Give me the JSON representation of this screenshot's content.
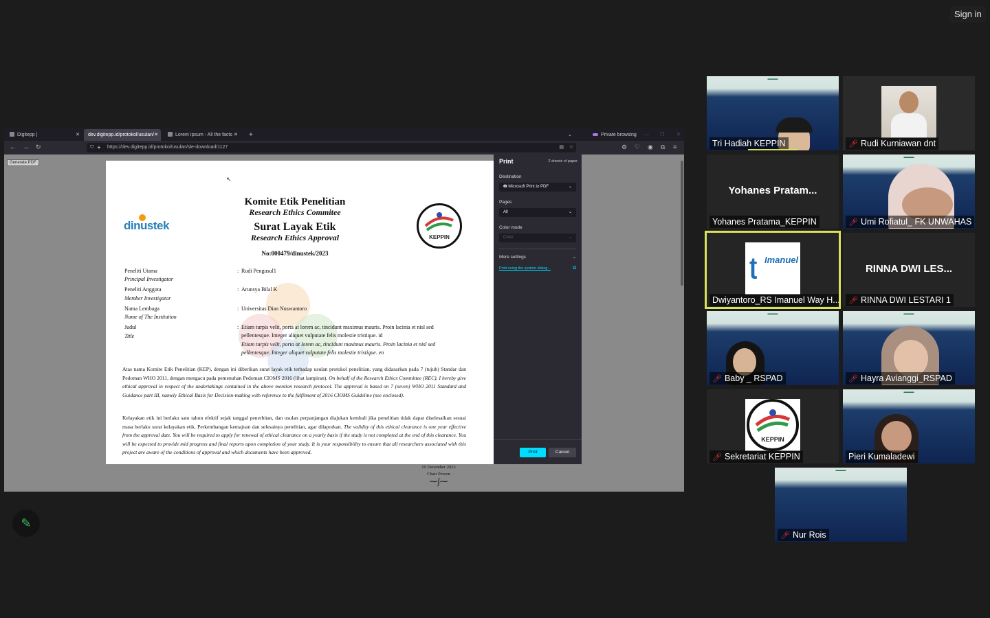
{
  "signin": "Sign in",
  "browser": {
    "tabs": [
      {
        "label": "Digitepp |"
      },
      {
        "label": "dev.digitepp.id/protokol/usulan/sle-"
      },
      {
        "label": "Lorem Ipsum - All the facts - Li"
      }
    ],
    "new_tab": "+",
    "private": "Private browsing",
    "url": "https://dev.digitepp.id/protokol/usulan/sle-download/1127",
    "generate_pdf": "Generate PDF"
  },
  "document": {
    "org_logo_text": "dinustek",
    "title1": "Komite Etik Penelitian",
    "title1_en": "Research Ethics Commitee",
    "title2": "Surat Layak Etik",
    "title2_en": "Research Ethics Approval",
    "number": "No:000479/dinustek/2023",
    "keppin_logo_text": "KEPPIN",
    "fields": [
      {
        "label": "Peneliti Utama",
        "label_en": "Principal Investigator",
        "value": "Rudi Pengusul1",
        "value_en": ""
      },
      {
        "label": "Peneliti Anggota",
        "label_en": "Member Investigator",
        "value": "Arunsya Bilal K",
        "value_en": ""
      },
      {
        "label": "Nama Lembaga",
        "label_en": "Name of The Institution",
        "value": "Universitas Dian Nuswantoro",
        "value_en": ""
      },
      {
        "label": "Judul",
        "label_en": "Title",
        "value": "Etiam turpis velit, porta at lorem ac, tincidunt maximus mauris. Proin lacinia et nisl sed pellentesque. Integer aliquet vulputate felis molestie tristique. id",
        "value_en": "Etiam turpis velit, porta at lorem ac, tincidunt maximus mauris. Proin lacinia et nisl sed pellentesque. Integer aliquet vulputate felis molestie tristique. en"
      }
    ],
    "colon": ":",
    "para1_id": "Atas nama Komite Etik Penelitian (KEP), dengan ini diberikan surat layak etik terhadap usulan protokol penelitian, yang didasarkan pada 7 (tujuh) Standar dan Pedoman WHO 2011, dengan mengacu pada pemenuhan Pedoman CIOMS 2016 (lihat lampiran).",
    "para1_en": "On behalf of the Research Ethics Committee (REC), I hereby give ethical approval in respect of the undertakings contained in the above mention research protocol. The approval is based on 7 (seven) WHO 2011 Standard and Guidance part III, namely Ethical Basis for Decision-making with reference to the fulfilment of 2016 CIOMS Guideline (see enclosed).",
    "para2_id": "Kelayakan etik ini berlaku satu tahun efektif sejak tanggal penerbitan, dan usulan perpanjangan diajukan kembali jika penelitian tidak dapat diselesaikan sesuai masa berlaku surat kelayakan etik. Perkembangan kemajuan dan selesainya penelitian, agar dilaporkan.",
    "para2_en": "The validity of this ethical clearance is one year effective from the approval date. You will be required to apply for renewal of ethical clearance on a yearly basis if the study is not completed at the end of this clearance. You will be expected to provide mid progress and final reports upon completion of your study. It is your responsibility to ensure that all researchers associated with this project are aware of the conditions of approval and which documents have been approved.",
    "date": "10 December 2023",
    "chair": "Chair Person"
  },
  "print_dialog": {
    "title": "Print",
    "sheets": "2 sheets of paper",
    "destination_label": "Destination",
    "destination_value": "Microsoft Print to PDF",
    "pages_label": "Pages",
    "pages_value": "All",
    "color_label": "Color mode",
    "color_value": "Color",
    "more_settings": "More settings",
    "system_dialog": "Print using the system dialog...",
    "print_btn": "Print",
    "cancel_btn": "Cancel",
    "accent": "#00ddff"
  },
  "participants": [
    {
      "name": "Tri Hadiah KEPPIN",
      "muted": false,
      "bg": "slide"
    },
    {
      "name": "Rudi Kurniawan dnt",
      "muted": true,
      "bg": "photo"
    },
    {
      "name": "Yohanes Pratama_KEPPIN",
      "muted": false,
      "bg": "name",
      "display": "Yohanes  Pratam..."
    },
    {
      "name": "Umi Rofiatul_ FK UNWAHAS",
      "muted": true,
      "bg": "slide"
    },
    {
      "name": "Dwiyantoro_RS Imanuel Way H...",
      "muted": false,
      "bg": "logo",
      "logo_text": "Imanuel",
      "active": true
    },
    {
      "name": "RINNA DWI LESTARI 1",
      "muted": true,
      "bg": "name",
      "display": "RINNA DWI LES..."
    },
    {
      "name": "Baby _ RSPAD",
      "muted": true,
      "bg": "slide"
    },
    {
      "name": "Hayra Avianggi_RSPAD",
      "muted": true,
      "bg": "slide"
    },
    {
      "name": "Sekretariat KEPPIN",
      "muted": true,
      "bg": "keppin",
      "logo_text": "KEPPIN"
    },
    {
      "name": "Pieri Kumaladewi",
      "muted": false,
      "bg": "slide"
    },
    {
      "name": "Nur Rois",
      "muted": true,
      "bg": "slide"
    }
  ],
  "colors": {
    "active_speaker": "#d8e35a",
    "mute": "#e0363c",
    "annotate": "#3fbf5f"
  }
}
